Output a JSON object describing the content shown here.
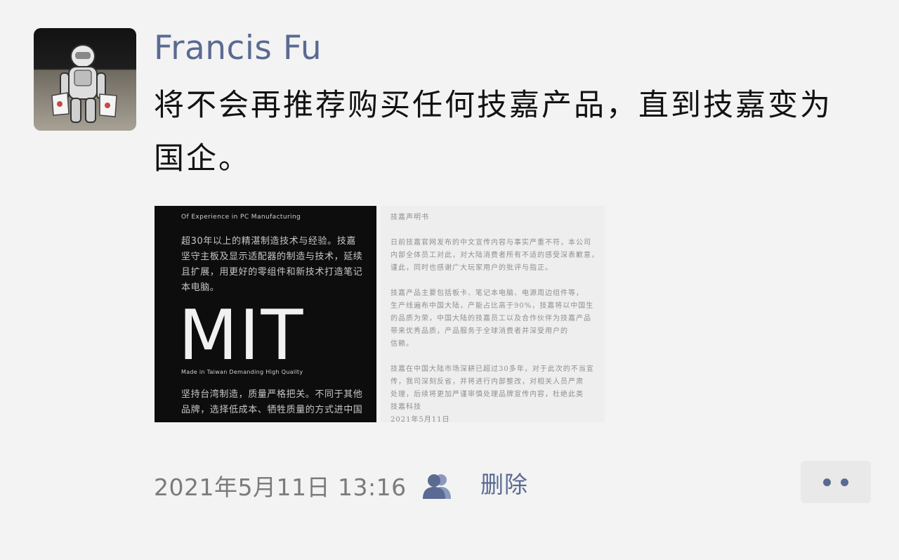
{
  "post": {
    "author": "Francis Fu",
    "text": "将不会再推荐购买任何技嘉产品，直到技嘉变为国企。",
    "images": [
      {
        "eyebrow": "Of Experience in PC Manufacturing",
        "para_top": "超30年以上的精湛制造技术与经验。技嘉坚守主板及显示适配器的制造与技术，延续且扩展，用更好的零组件和新技术打造笔记本电脑。",
        "headline": "MIT",
        "headline_sub": "Made in Taiwan Demanding High Quality",
        "para_bottom": "坚持台湾制造，质量严格把关。不同于其他品牌，选择低成本、牺牲质量的方式进中国"
      },
      {
        "lines": [
          "技嘉声明书",
          "",
          "日前技嘉官网发布的中文宣传内容与事实严重不符，本公司",
          "内部全体员工对此，对大陆消费者所有不适的感受深表歉意，",
          "谨此，同时也感谢广大玩家用户的批评与指正。",
          "",
          "技嘉产品主要包括板卡、笔记本电脑、电源周边组件等，",
          "生产线遍布中国大陆，产能占比高于90%，技嘉将以中国生产",
          "的品质为荣，中国大陆的技嘉员工以及合作伙伴为技嘉产品",
          "带来优秀品质，产品服务于全球消费者并深受用户的",
          "信赖。",
          "",
          "技嘉在中国大陆市场深耕已超过30多年，对于此次的不当宣",
          "传，我司深刻反省，并将进行内部整改，对相关人员严肃",
          "处理，后续将更加严谨审慎处理品牌宣传内容，杜绝此类",
          "事件再次发生。",
          "",
          "技嘉科技",
          "2021年5月11日"
        ]
      }
    ],
    "timestamp": "2021年5月11日  13:16",
    "visibility_icon": "people-icon",
    "delete_label": "删除",
    "more_icon": "more-dots-icon",
    "colors": {
      "accent": "#5a6a93",
      "background": "#f3f3f3",
      "text": "#121212",
      "muted": "#7b7b7b"
    }
  }
}
